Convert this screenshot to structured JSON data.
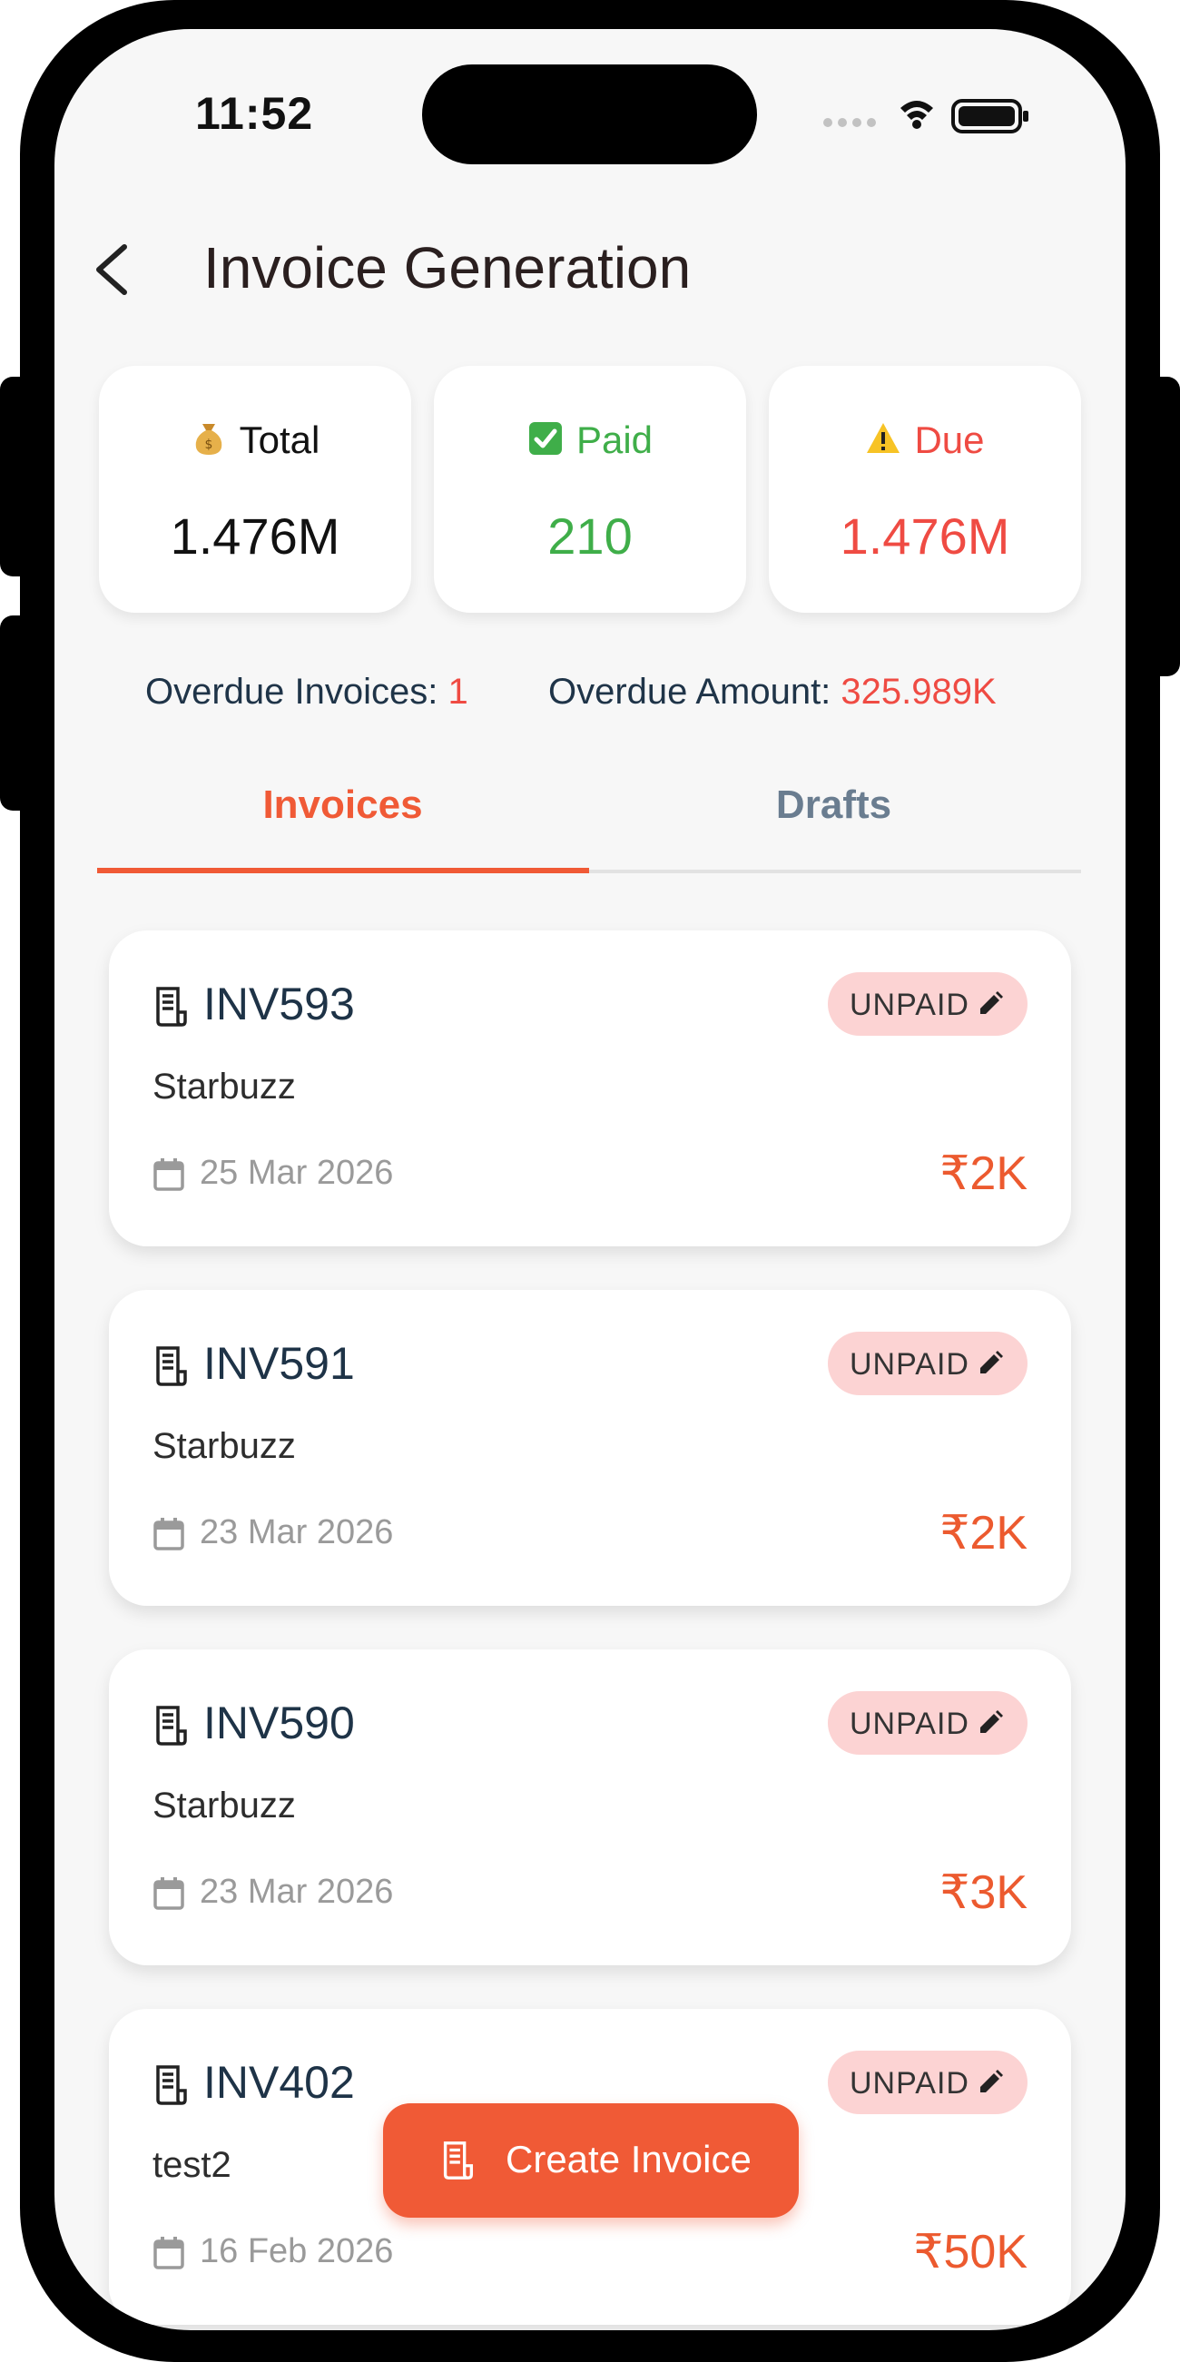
{
  "status_bar": {
    "time": "11:52"
  },
  "header": {
    "title": "Invoice Generation"
  },
  "stats": {
    "total": {
      "icon": "money-bag-icon",
      "label": "Total",
      "value": "1.476M"
    },
    "paid": {
      "icon": "check-box-icon",
      "label": "Paid",
      "value": "210"
    },
    "due": {
      "icon": "warning-icon",
      "label": "Due",
      "value": "1.476M"
    }
  },
  "overdue": {
    "invoices_label": "Overdue Invoices: ",
    "invoices_value": "1",
    "amount_label": "Overdue Amount: ",
    "amount_value": "325.989K"
  },
  "tabs": [
    {
      "label": "Invoices",
      "active": true
    },
    {
      "label": "Drafts",
      "active": false
    }
  ],
  "invoices": [
    {
      "id": "INV593",
      "client": "Starbuzz",
      "date": "25 Mar 2026",
      "amount": "₹2K",
      "status": "UNPAID"
    },
    {
      "id": "INV591",
      "client": "Starbuzz",
      "date": "23 Mar 2026",
      "amount": "₹2K",
      "status": "UNPAID"
    },
    {
      "id": "INV590",
      "client": "Starbuzz",
      "date": "23 Mar 2026",
      "amount": "₹3K",
      "status": "UNPAID"
    },
    {
      "id": "INV402",
      "client": "test2",
      "date": "16 Feb 2026",
      "amount": "₹50K",
      "status": "UNPAID"
    }
  ],
  "fab": {
    "label": "Create Invoice"
  },
  "colors": {
    "accent": "#f05a36",
    "paid_green": "#3fae49",
    "due_red": "#ef4b43",
    "badge_bg": "#fcd3d3"
  }
}
